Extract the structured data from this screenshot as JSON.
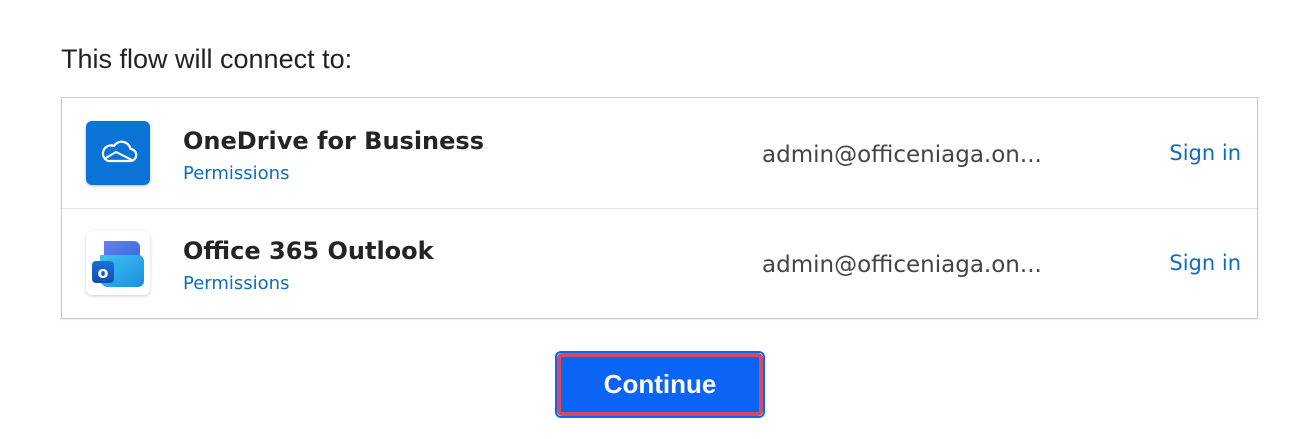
{
  "heading": "This flow will connect to:",
  "connections": [
    {
      "name": "OneDrive for Business",
      "permissions_label": "Permissions",
      "account": "admin@officeniaga.on...",
      "sign_in_label": "Sign in",
      "icon": "onedrive-cloud-icon"
    },
    {
      "name": "Office 365 Outlook",
      "permissions_label": "Permissions",
      "account": "admin@officeniaga.on...",
      "sign_in_label": "Sign in",
      "icon": "outlook-icon"
    }
  ],
  "continue_label": "Continue",
  "colors": {
    "link": "#0f6cbd",
    "primary_button": "#0a64f5",
    "highlight_border": "#d54b5e",
    "onedrive_tile": "#0a74d6"
  }
}
